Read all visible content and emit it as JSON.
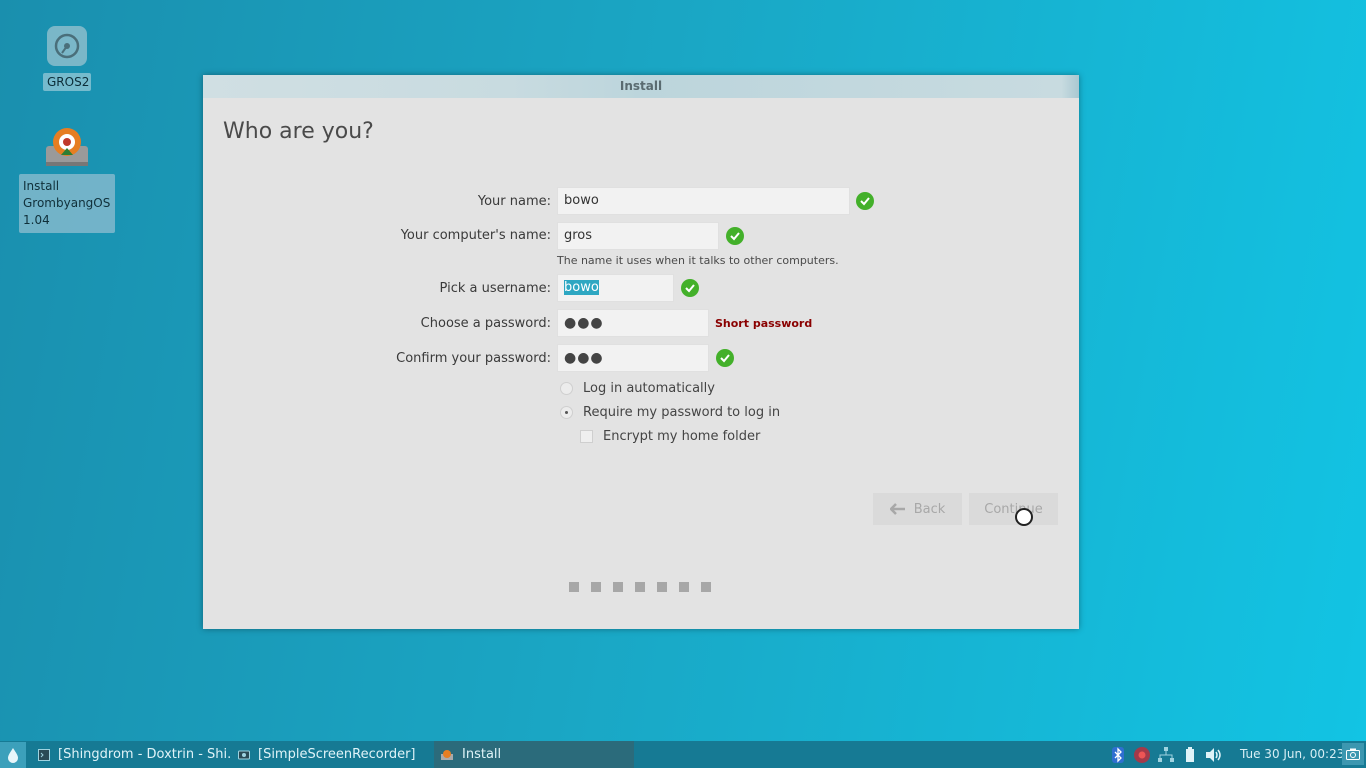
{
  "desktop": {
    "icons": [
      {
        "label": "GROS2",
        "icon": "disk-icon"
      },
      {
        "label": "Install GrombyangOS 1.04",
        "icon": "installer-icon"
      }
    ]
  },
  "window": {
    "title": "Install",
    "heading": "Who are you?",
    "form": {
      "name_label": "Your name:",
      "name_value": "bowo",
      "computer_label": "Your computer's name:",
      "computer_value": "gros",
      "computer_hint": "The name it uses when it talks to other computers.",
      "username_label": "Pick a username:",
      "username_value": "bowo",
      "password_label": "Choose a password:",
      "password_value": "●●●",
      "password_warning": "Short password",
      "confirm_label": "Confirm your password:",
      "confirm_value": "●●●",
      "login_auto": "Log in automatically",
      "login_require": "Require my password to log in",
      "encrypt_home": "Encrypt my home folder"
    },
    "buttons": {
      "back": "Back",
      "continue": "Continue"
    },
    "progress_steps": 7
  },
  "taskbar": {
    "tasks": [
      {
        "label": "[Shingdrom - Doxtrin - Shi..."
      },
      {
        "label": "[SimpleScreenRecorder]"
      },
      {
        "label": "Install"
      }
    ],
    "clock": "Tue 30 Jun, 00:23"
  }
}
